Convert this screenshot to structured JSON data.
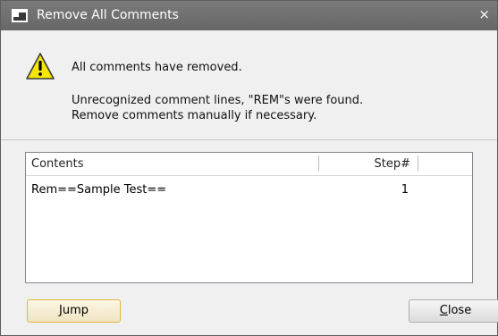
{
  "window": {
    "title": "Remove All Comments",
    "close_glyph": "×"
  },
  "message": {
    "line1": "All comments have removed.",
    "line2": "Unrecognized comment lines, \"REM\"s were found.",
    "line3": "Remove comments manually if necessary."
  },
  "table": {
    "columns": [
      "Contents",
      "Step#"
    ],
    "rows": [
      {
        "contents": "Rem==Sample Test==",
        "step": "1"
      }
    ]
  },
  "buttons": {
    "jump_first": "J",
    "jump_rest": "ump",
    "close_first": "C",
    "close_rest": "lose"
  },
  "icons": {
    "title": "dialog-app-icon",
    "warning": "warning-triangle-icon"
  },
  "colors": {
    "titlebar": "#6e6e6e",
    "warning_fill": "#f5e500",
    "jump_border": "#e3b53e"
  }
}
